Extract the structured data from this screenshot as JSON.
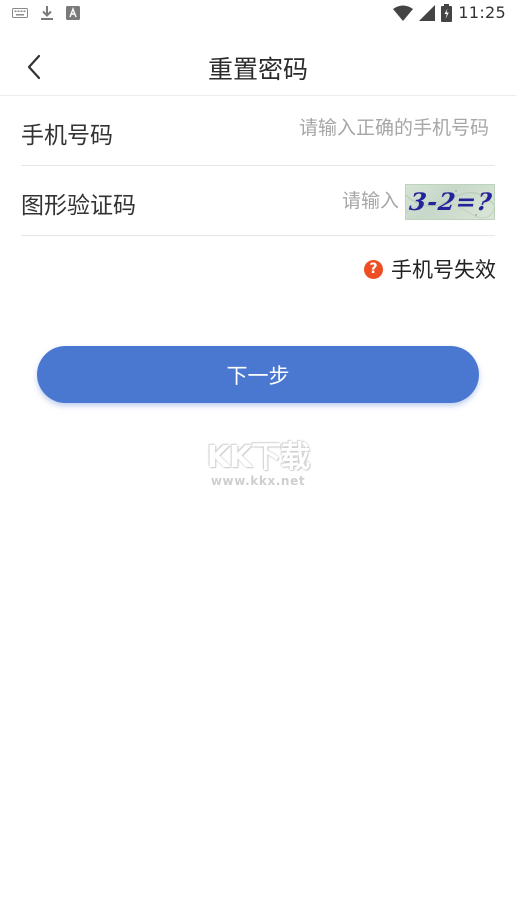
{
  "status_bar": {
    "left_icons": [
      "keyboard-icon",
      "download-icon",
      "font-icon"
    ],
    "right_icons": [
      "wifi-icon",
      "signal-icon",
      "battery-icon"
    ],
    "time": "11:25"
  },
  "nav": {
    "back_icon": "chevron-left-icon",
    "title": "重置密码"
  },
  "form": {
    "phone": {
      "label": "手机号码",
      "value": "",
      "placeholder": "请输入正确的手机号码"
    },
    "captcha": {
      "label": "图形验证码",
      "value": "",
      "placeholder": "请输入",
      "image_text": "3-2=?"
    }
  },
  "phone_invalid": {
    "icon": "question-circle-icon",
    "label": "手机号失效"
  },
  "next_button": {
    "label": "下一步"
  },
  "watermark": {
    "logo_text": "KK下载",
    "url": "www.kkx.net"
  },
  "colors": {
    "accent": "#4a78d0",
    "help_icon": "#ef4e22",
    "captcha_text": "#24249a"
  }
}
